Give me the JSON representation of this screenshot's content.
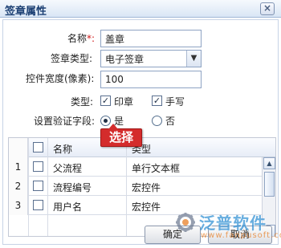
{
  "dialog": {
    "title": "签章属性",
    "close_icon": "×"
  },
  "form": {
    "name_label": "名称",
    "required_mark": "*:",
    "name_value": "盖章",
    "signature_type_label": "签章类型:",
    "signature_type_value": "电子签章",
    "control_width_label": "控件宽度(像素):",
    "control_width_value": "100",
    "type_label": "类型:",
    "type_options": [
      {
        "label": "印章",
        "checked": true
      },
      {
        "label": "手写",
        "checked": true
      }
    ],
    "verify_field_label": "设置验证字段:",
    "verify_options": [
      {
        "label": "是",
        "selected": true
      },
      {
        "label": "否",
        "selected": false
      }
    ]
  },
  "grid": {
    "headers": {
      "name": "名称",
      "type": "类型"
    },
    "rows": [
      {
        "num": "1",
        "name": "父流程",
        "type": "单行文本框"
      },
      {
        "num": "2",
        "name": "流程编号",
        "type": "宏控件"
      },
      {
        "num": "3",
        "name": "用户名",
        "type": "宏控件"
      }
    ]
  },
  "tooltip": {
    "text": "选择"
  },
  "buttons": {
    "ok": "确定",
    "cancel": "取消"
  },
  "watermark": {
    "brand": "泛普软件",
    "url": "www.fanpusoft.com"
  },
  "icons": {
    "close": "close-icon",
    "dropdown": "chevron-down-icon",
    "scroll_up": "chevron-up-icon",
    "scroll_down": "chevron-down-icon",
    "logo": "gear-icon"
  },
  "colors": {
    "title": "#1b3f73",
    "accent": "#2f8fd4",
    "tooltip": "#d42c2c"
  }
}
